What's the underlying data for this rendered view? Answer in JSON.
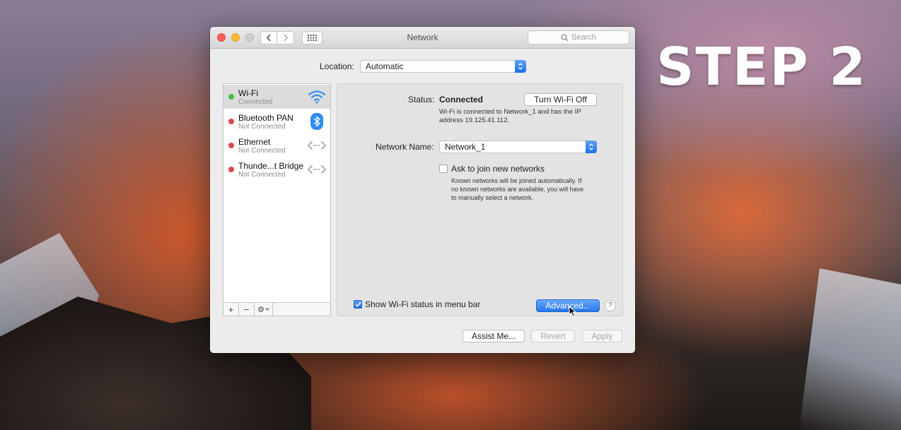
{
  "overlay": {
    "step_text": "STEP 2"
  },
  "window": {
    "title": "Network",
    "search_placeholder": "Search"
  },
  "location": {
    "label": "Location:",
    "value": "Automatic"
  },
  "services": [
    {
      "name": "Wi-Fi",
      "status": "Connected",
      "dot_color": "#3ec33e",
      "icon": "wifi-icon",
      "selected": true
    },
    {
      "name": "Bluetooth PAN",
      "status": "Not Connected",
      "dot_color": "#e2474b",
      "icon": "bluetooth-icon",
      "selected": false
    },
    {
      "name": "Ethernet",
      "status": "Not Connected",
      "dot_color": "#e2474b",
      "icon": "ethernet-arrows-icon",
      "selected": false
    },
    {
      "name": "Thunde...t Bridge",
      "status": "Not Connected",
      "dot_color": "#e2474b",
      "icon": "ethernet-arrows-icon",
      "selected": false
    }
  ],
  "sidebar_toolbar": {
    "add": "+",
    "remove": "−",
    "gear": "⚙"
  },
  "detail": {
    "status_label": "Status:",
    "status_value": "Connected",
    "turn_off_button": "Turn Wi-Fi Off",
    "status_desc_line1": "Wi-Fi is connected to Network_1 and has the IP",
    "status_desc_line2": "address 19.125.41.112.",
    "network_name_label": "Network Name:",
    "network_name_value": "Network_1",
    "ask_join_label": "Ask to join new networks",
    "ask_join_checked": false,
    "ask_desc_line1": "Known networks will be joined automatically. If",
    "ask_desc_line2": "no known networks are available, you will have",
    "ask_desc_line3": "to manually select a network.",
    "show_status_label": "Show Wi-Fi status in menu bar",
    "show_status_checked": true,
    "advanced_button": "Advanced...",
    "help": "?"
  },
  "footer": {
    "assist_button": "Assist Me...",
    "revert_button": "Revert",
    "apply_button": "Apply"
  },
  "colors": {
    "accent_blue": "#1b6fe8",
    "connected_green": "#3ec33e",
    "disconnected_red": "#e2474b"
  }
}
